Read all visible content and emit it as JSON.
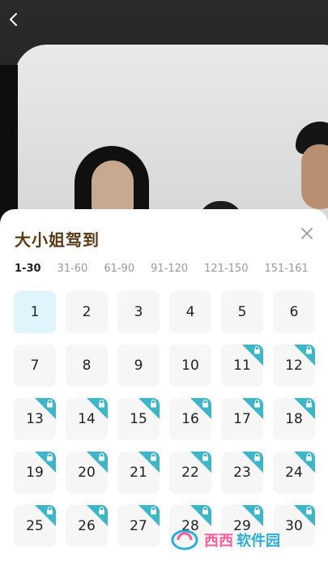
{
  "header": {
    "back_icon": "chevron-left-icon"
  },
  "sheet": {
    "title": "大小姐驾到",
    "close_icon": "close-icon",
    "ranges": [
      "1-30",
      "31-60",
      "61-90",
      "91-120",
      "121-150",
      "151-161"
    ],
    "active_range": "1-30",
    "episodes": [
      {
        "n": "1",
        "locked": false,
        "active": true
      },
      {
        "n": "2",
        "locked": false
      },
      {
        "n": "3",
        "locked": false
      },
      {
        "n": "4",
        "locked": false
      },
      {
        "n": "5",
        "locked": false
      },
      {
        "n": "6",
        "locked": false
      },
      {
        "n": "7",
        "locked": false
      },
      {
        "n": "8",
        "locked": false
      },
      {
        "n": "9",
        "locked": false
      },
      {
        "n": "10",
        "locked": false
      },
      {
        "n": "11",
        "locked": true
      },
      {
        "n": "12",
        "locked": true
      },
      {
        "n": "13",
        "locked": true
      },
      {
        "n": "14",
        "locked": true
      },
      {
        "n": "15",
        "locked": true
      },
      {
        "n": "16",
        "locked": true
      },
      {
        "n": "17",
        "locked": true
      },
      {
        "n": "18",
        "locked": true
      },
      {
        "n": "19",
        "locked": true
      },
      {
        "n": "20",
        "locked": true
      },
      {
        "n": "21",
        "locked": true
      },
      {
        "n": "22",
        "locked": true
      },
      {
        "n": "23",
        "locked": true
      },
      {
        "n": "24",
        "locked": true
      },
      {
        "n": "25",
        "locked": true
      },
      {
        "n": "26",
        "locked": true
      },
      {
        "n": "27",
        "locked": true
      },
      {
        "n": "28",
        "locked": true
      },
      {
        "n": "29",
        "locked": true
      },
      {
        "n": "30",
        "locked": true
      }
    ]
  },
  "watermark": {
    "text": "西西",
    "sub": "软件园",
    "domain": "CR173.COM"
  },
  "colors": {
    "accent": "#3cb6c8",
    "active_tile": "#dff4fb",
    "title": "#5a3a14"
  }
}
